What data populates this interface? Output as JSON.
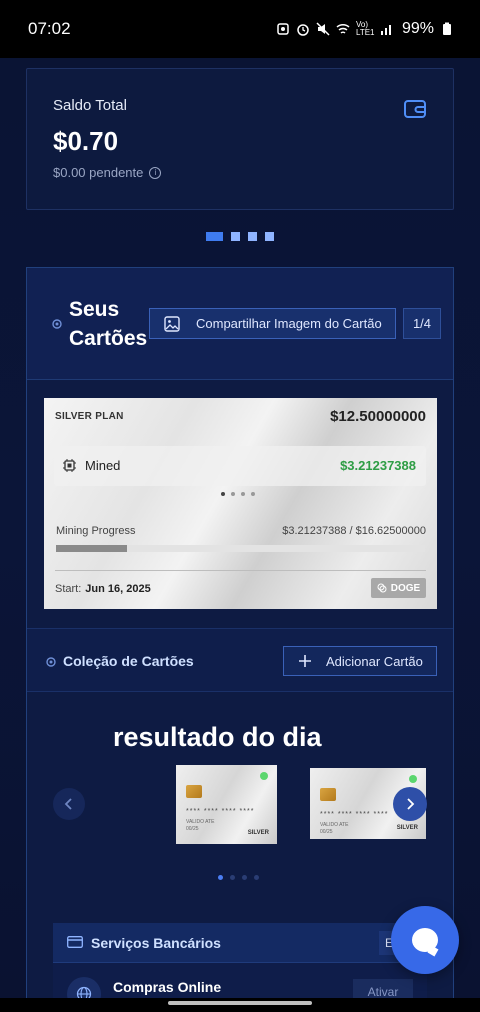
{
  "status_bar": {
    "time": "07:02",
    "network": "Vo) LTE1",
    "battery": "99%"
  },
  "balance": {
    "label": "Saldo Total",
    "value": "$0.70",
    "pending": "$0.00 pendente"
  },
  "pager": {
    "count": 4,
    "active": 0
  },
  "cards": {
    "title_line1": "Seus",
    "title_line2": "Cartões",
    "share_label": "Compartilhar Imagem do Cartão",
    "page_indicator": "1/4",
    "silver_card": {
      "plan": "SILVER PLAN",
      "amount": "$12.50000000",
      "mined_label": "Mined",
      "mined_value": "$3.21237388",
      "progress_label": "Mining Progress",
      "progress_value": "$3.21237388 / $16.62500000",
      "progress_fraction": 0.1932,
      "start_label": "Start:",
      "start_date": "Jun 16, 2025",
      "coin": "DOGE"
    }
  },
  "collection": {
    "title": "Coleção de Cartões",
    "add_label": "Adicionar Cartão"
  },
  "carousel": {
    "title": "resultado do dia",
    "card_number": "**** **** **** ****",
    "card_name": "VALIDO ATE",
    "card_exp": "00/25",
    "card_tier": "SILVER"
  },
  "banking": {
    "title": "Serviços Bancários",
    "badge": "Em Breve",
    "service_name": "Compras Online",
    "service_button": "Ativar"
  },
  "colors": {
    "background": "#0b1433",
    "accent": "#3769e8",
    "mined_green": "#2e9d45"
  }
}
